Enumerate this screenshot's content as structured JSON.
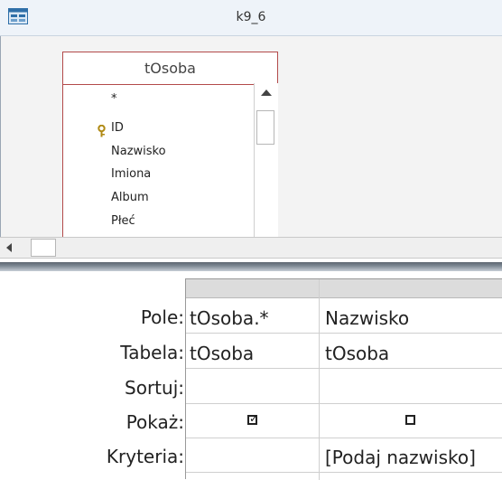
{
  "window": {
    "title": "k9_6",
    "icon": "query-design-icon"
  },
  "table_box": {
    "title": "tOsoba",
    "fields": [
      "*",
      "ID",
      "Nazwisko",
      "Imiona",
      "Album",
      "Płeć"
    ],
    "key_field_icon": "primary-key-icon"
  },
  "grid": {
    "row_labels": [
      "Pole:",
      "Tabela:",
      "Sortuj:",
      "Pokaż:",
      "Kryteria:"
    ],
    "columns": [
      {
        "field": "tOsoba.*",
        "table": "tOsoba",
        "sort": "",
        "show": true,
        "criteria": ""
      },
      {
        "field": "Nazwisko",
        "table": "tOsoba",
        "sort": "",
        "show": false,
        "criteria": "[Podaj nazwisko]"
      }
    ]
  },
  "colors": {
    "table_border": "#b34a4a",
    "splitter": "#6b7580",
    "header_gray": "#dcdcdc"
  }
}
